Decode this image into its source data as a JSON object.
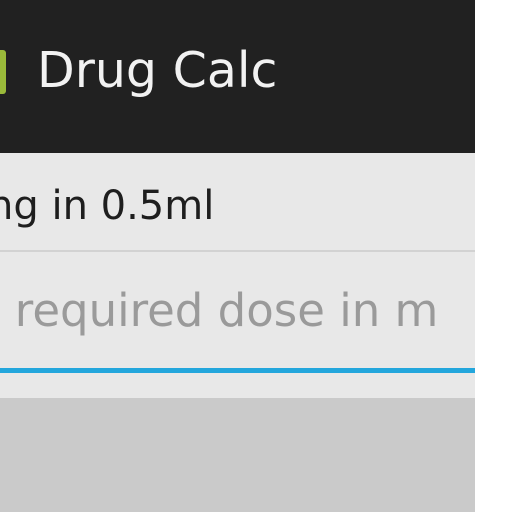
{
  "action_bar": {
    "title": "Drug Calc",
    "icon": "app-launcher-icon",
    "background": "#212121",
    "icon_color": "#9aba3a"
  },
  "strength": {
    "text": "ng in 0.5ml"
  },
  "dose_input": {
    "value": "",
    "placeholder": "r required dose in m",
    "accent": "#23a6dc"
  },
  "button": {
    "label": "",
    "background": "#cacaca"
  }
}
